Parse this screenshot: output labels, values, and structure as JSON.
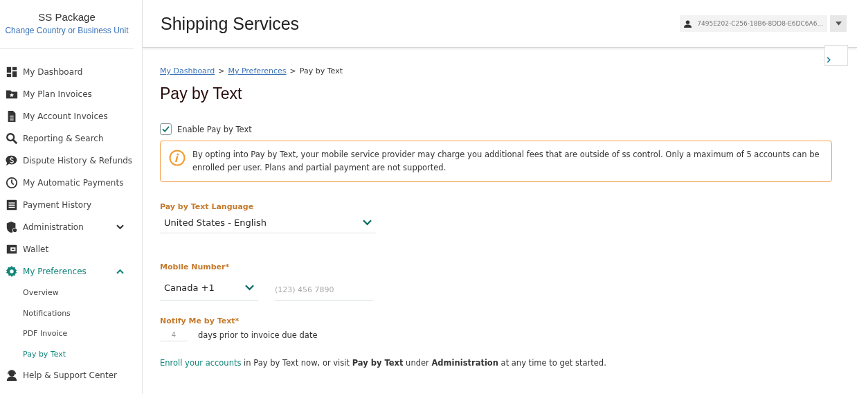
{
  "sidebar": {
    "package": "SS Package",
    "change_link": "Change Country or Business Unit",
    "items": [
      {
        "label": "My Dashboard",
        "selected": false
      },
      {
        "label": "My Plan Invoices",
        "selected": false
      },
      {
        "label": "My Account Invoices",
        "selected": false
      },
      {
        "label": "Reporting & Search",
        "selected": false
      },
      {
        "label": "Dispute History & Refunds",
        "selected": false
      },
      {
        "label": "My Automatic Payments",
        "selected": false
      },
      {
        "label": "Payment History",
        "selected": false
      },
      {
        "label": "Administration",
        "selected": false,
        "expanded": false
      },
      {
        "label": "Wallet",
        "selected": false
      },
      {
        "label": "My Preferences",
        "selected": true,
        "expanded": true,
        "children": [
          {
            "label": "Overview",
            "selected": false
          },
          {
            "label": "Notifications",
            "selected": false
          },
          {
            "label": "PDF Invoice",
            "selected": false
          },
          {
            "label": "Pay by Text",
            "selected": true
          }
        ]
      },
      {
        "label": "Help & Support Center",
        "selected": false
      }
    ]
  },
  "header": {
    "title": "Shipping Services",
    "user": "7495E202-C256-18B6-8DD8-E6DC6A6..."
  },
  "breadcrumb": [
    {
      "label": "My Dashboard",
      "link": true,
      "separator": ">"
    },
    {
      "label": "My Preferences",
      "link": true,
      "separator": ">"
    },
    {
      "label": "Pay by Text",
      "link": false
    }
  ],
  "page_title": "Pay by Text",
  "enable": {
    "label": "Enable Pay by Text",
    "checked": true
  },
  "notice": "By opting into Pay by Text, your mobile service provider may charge you additional fees that are outside of ss control. Only a maximum of 5 accounts can be enrolled per user. Plans and partial payment are not supported.",
  "language": {
    "label": "Pay by Text Language",
    "value": "United States - English"
  },
  "mobile": {
    "label": "Mobile Number*",
    "country": "Canada +1",
    "placeholder": "(123) 456 7890"
  },
  "notify": {
    "label": "Notify Me by Text*",
    "value": "4",
    "suffix": "days prior to invoice due date"
  },
  "enroll": {
    "link": "Enroll your accounts",
    "text": "in Pay by Text now, or visit **Pay by Text** under **Administration** at any time to get started."
  }
}
